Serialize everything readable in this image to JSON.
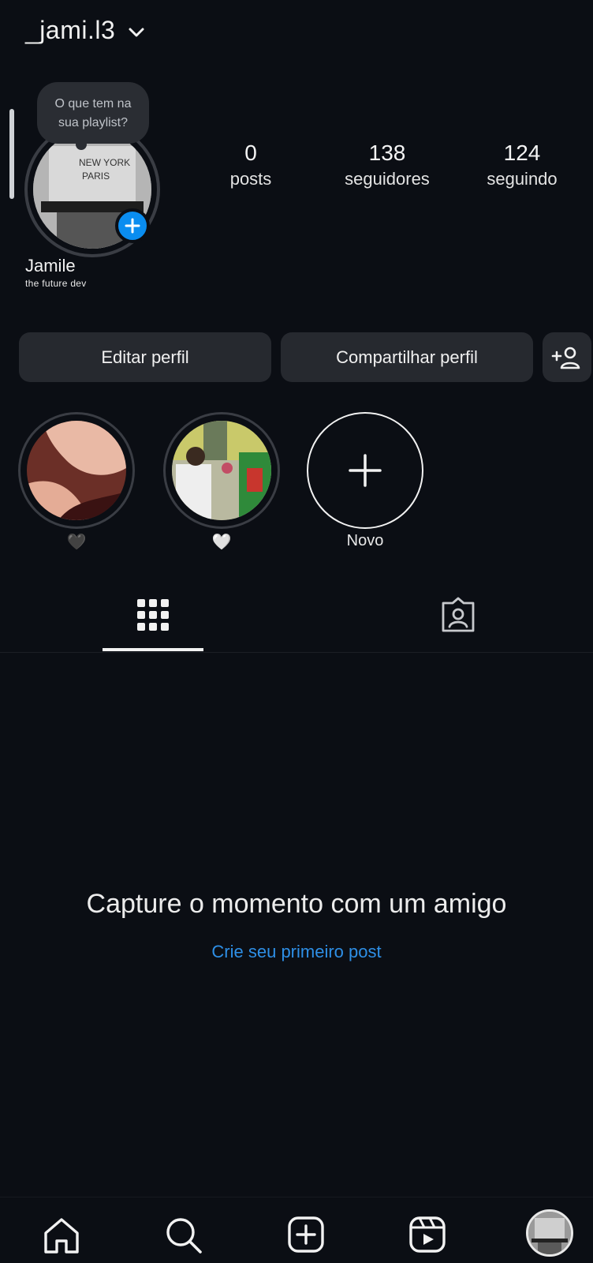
{
  "header": {
    "username": "_jami.l3",
    "switch_icon": "chevron-down-icon"
  },
  "profile": {
    "note": "O que tem na sua playlist?",
    "note_line1": "O que tem na",
    "note_line2": "sua playlist?",
    "name": "Jamile",
    "bio": "the future dev",
    "add_story_icon": "plus-icon"
  },
  "stats": {
    "posts": {
      "value": "0",
      "label": "posts"
    },
    "followers": {
      "value": "138",
      "label": "seguidores"
    },
    "following": {
      "value": "124",
      "label": "seguindo"
    }
  },
  "actions": {
    "edit_label": "Editar perfil",
    "share_label": "Compartilhar perfil",
    "discover_icon": "add-person-icon"
  },
  "highlights": [
    {
      "caption": "🖤"
    },
    {
      "caption": "🤍"
    },
    {
      "caption": "Novo",
      "icon": "plus-icon"
    }
  ],
  "tabs": [
    {
      "icon": "grid-icon",
      "active": true
    },
    {
      "icon": "tagged-icon",
      "active": false
    }
  ],
  "empty_state": {
    "title": "Capture o momento com um amigo",
    "link": "Crie seu primeiro post"
  },
  "bottom_nav": [
    {
      "icon": "home-icon"
    },
    {
      "icon": "search-icon"
    },
    {
      "icon": "create-icon"
    },
    {
      "icon": "reels-icon"
    },
    {
      "icon": "profile-avatar"
    }
  ],
  "colors": {
    "background": "#0b0e14",
    "accent_blue": "#0a8df0",
    "link_blue": "#2e8fe6",
    "button_bg": "#26292f"
  }
}
